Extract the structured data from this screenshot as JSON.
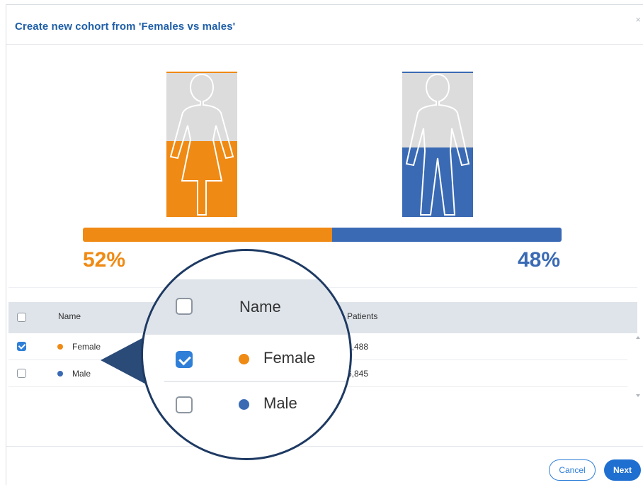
{
  "dialog": {
    "title": "Create new cohort from 'Females vs males'",
    "close_glyph": "×"
  },
  "groups": [
    {
      "name": "Female",
      "color": "#ef8a14",
      "percent": 52,
      "percent_label": "52%",
      "patients": "7,488",
      "checked": true,
      "icon": "female-figure-icon"
    },
    {
      "name": "Male",
      "color": "#3a6ab4",
      "percent": 48,
      "percent_label": "48%",
      "patients": "6,845",
      "checked": false,
      "icon": "male-figure-icon"
    }
  ],
  "table": {
    "columns": {
      "name": "Name",
      "patients": "Patients"
    },
    "rows": [
      {
        "name": "Female",
        "patients": "7,488",
        "checked": true,
        "color": "#ef8a14"
      },
      {
        "name": "Male",
        "patients": "6,845",
        "checked": false,
        "color": "#3a6ab4"
      }
    ]
  },
  "magnifier": {
    "header": "Name",
    "rows": [
      {
        "name": "Female",
        "checked": true,
        "color": "#ef8a14"
      },
      {
        "name": "Male",
        "checked": false,
        "color": "#3a6ab4"
      }
    ]
  },
  "footer": {
    "cancel_label": "Cancel",
    "next_label": "Next"
  }
}
